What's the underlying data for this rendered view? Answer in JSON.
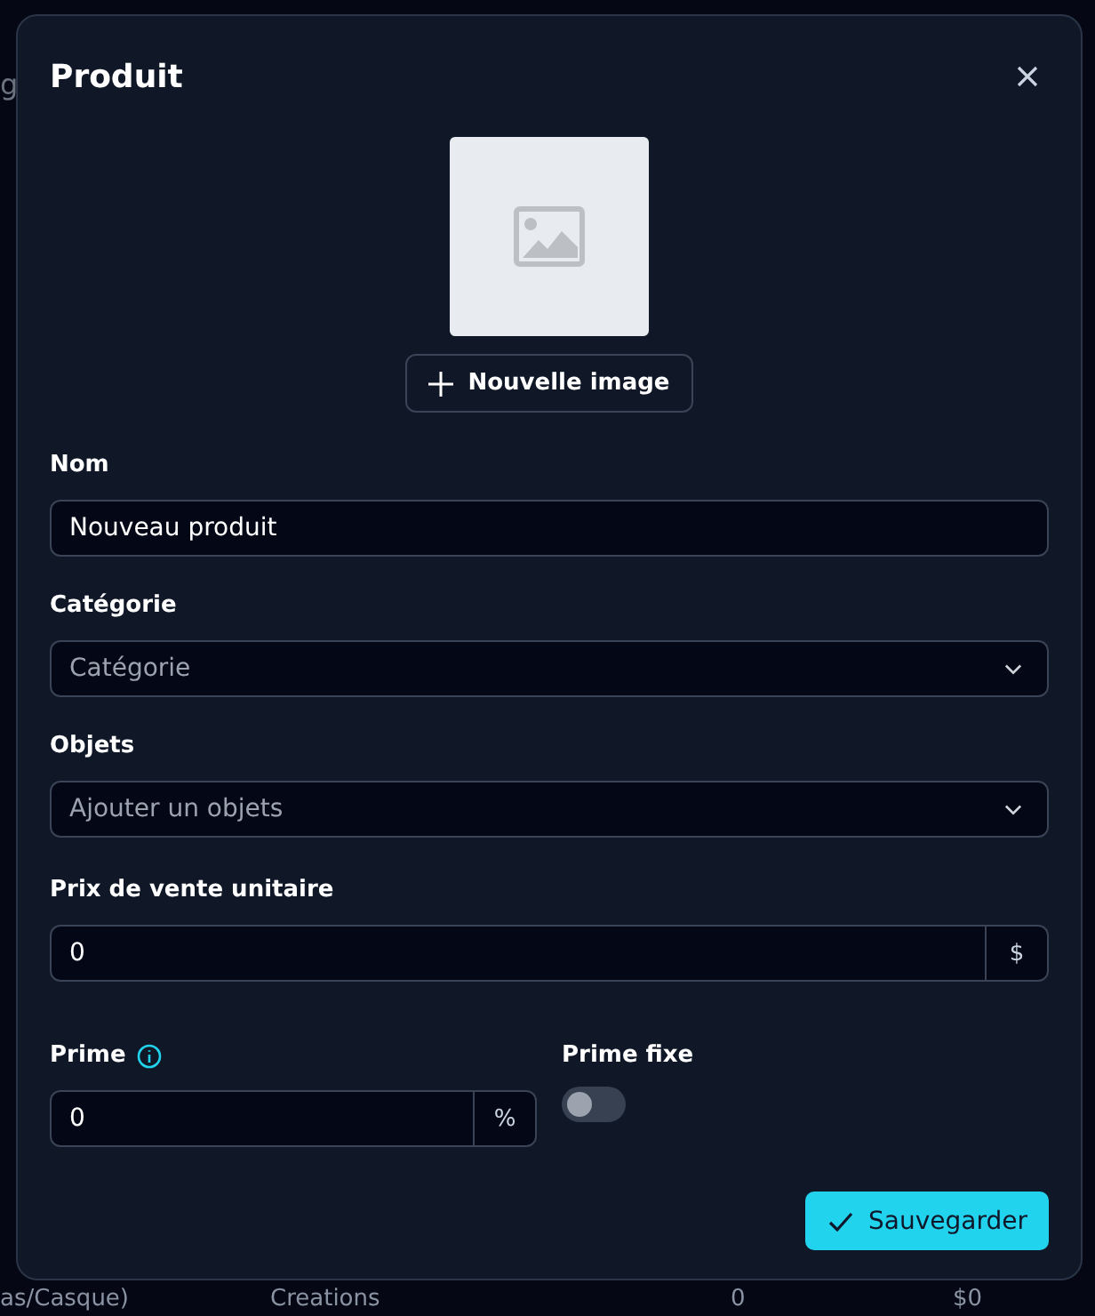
{
  "background": {
    "side_text": "g",
    "row": {
      "name": "as/Casque)",
      "category": "Creations",
      "quantity": "0",
      "price": "$0"
    }
  },
  "dialog": {
    "title": "Produit",
    "image_button": "Nouvelle image",
    "fields": [
      {
        "kind": "text",
        "label": "Nom",
        "value": "Nouveau produit"
      },
      {
        "kind": "select",
        "label": "Catégorie",
        "placeholder": "Catégorie"
      },
      {
        "kind": "select",
        "label": "Objets",
        "placeholder": "Ajouter un objets"
      },
      {
        "kind": "addon",
        "label": "Prix de vente unitaire",
        "value": "0",
        "suffix": "$"
      }
    ],
    "prime": {
      "label": "Prime",
      "value": "0",
      "suffix": "%"
    },
    "prime_fixe": {
      "label": "Prime fixe",
      "on": false
    },
    "save_button": "Sauvegarder"
  }
}
